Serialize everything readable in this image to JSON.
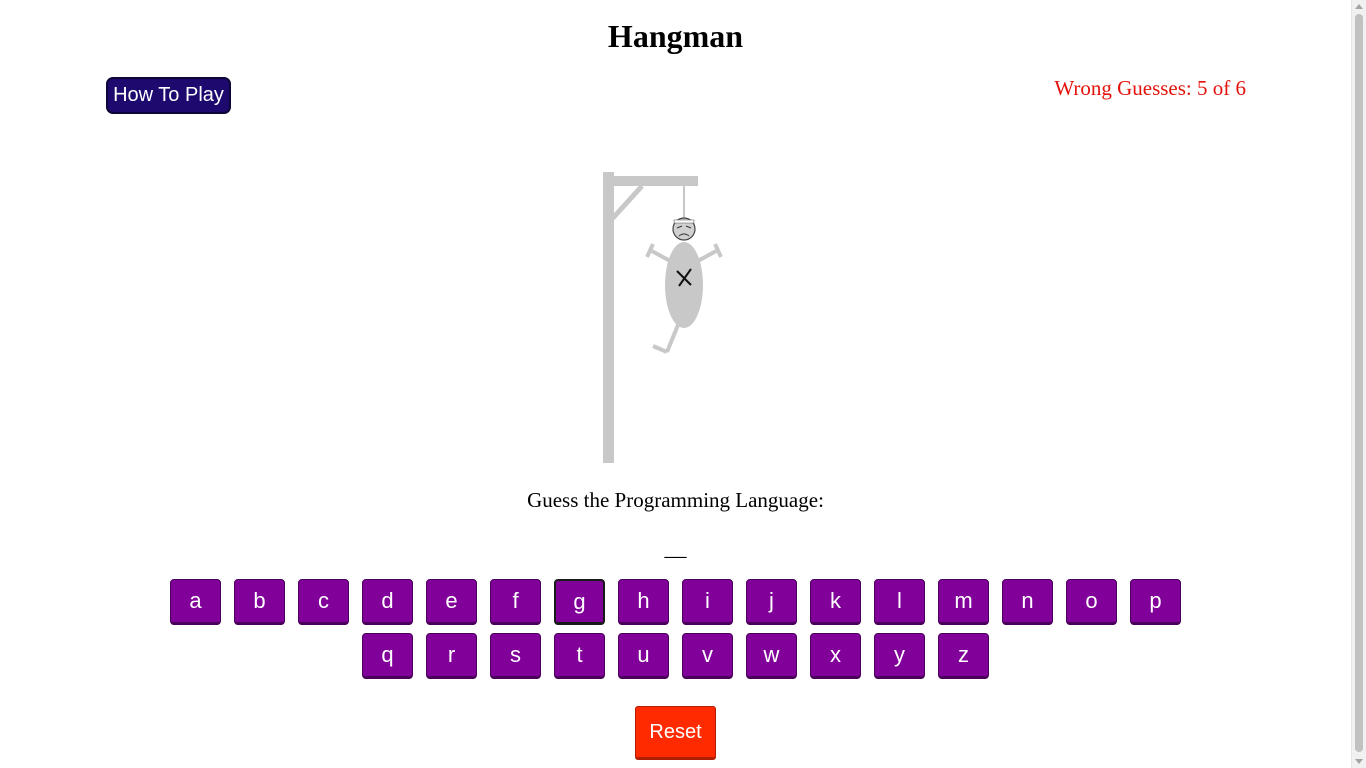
{
  "header": {
    "title": "Hangman",
    "how_to_play_label": "How To Play"
  },
  "status": {
    "wrong_guesses_text": "Wrong Guesses: 5 of 6",
    "wrong_guesses": 5,
    "max_wrong": 6,
    "color": "#e3120b"
  },
  "game": {
    "prompt": "Guess the Programming Language:",
    "word_display": "__",
    "used_letters": [
      "g"
    ]
  },
  "keyboard": {
    "row1": [
      "a",
      "b",
      "c",
      "d",
      "e",
      "f",
      "g",
      "h",
      "i",
      "j",
      "k",
      "l",
      "m",
      "n",
      "o",
      "p"
    ],
    "row2": [
      "q",
      "r",
      "s",
      "t",
      "u",
      "v",
      "w",
      "x",
      "y",
      "z"
    ]
  },
  "controls": {
    "reset_label": "Reset"
  },
  "colors": {
    "key": "#800099",
    "reset": "#ff2a00",
    "how_to_play": "#1e0a6e",
    "gallows": "#c8c8c8"
  }
}
